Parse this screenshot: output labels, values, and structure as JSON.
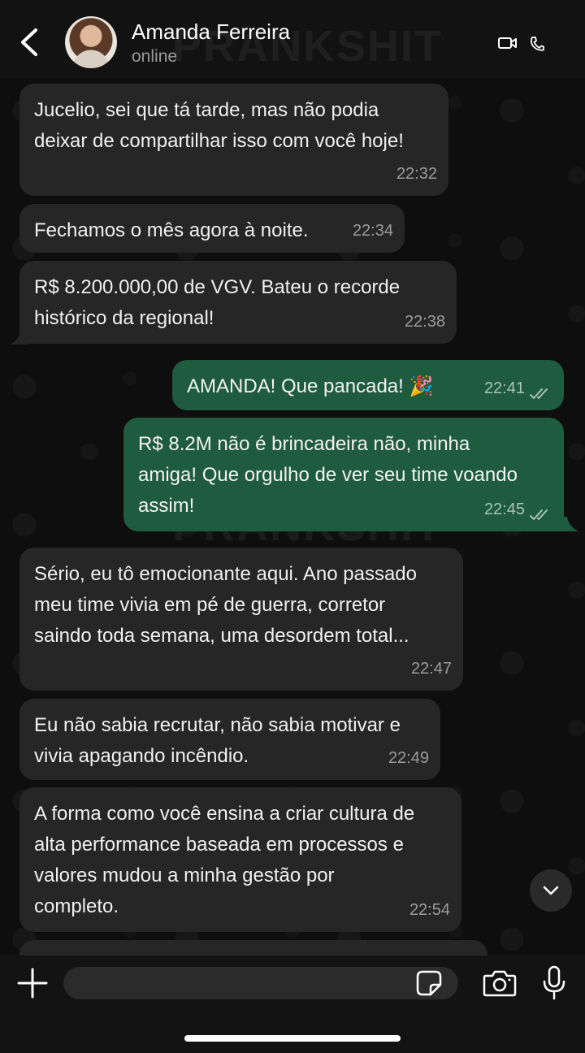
{
  "header": {
    "contact_name": "Amanda Ferreira",
    "status": "online",
    "back_icon": "chevron-left-icon",
    "video_icon": "video-call-icon",
    "phone_icon": "phone-icon"
  },
  "watermark": "PRANKSHIT",
  "messages": [
    {
      "direction": "incoming",
      "text": "Jucelio, sei que tá tarde, mas não podia\ndeixar de compartilhar isso com você hoje!",
      "time": "22:32"
    },
    {
      "direction": "incoming",
      "text": "Fechamos o mês agora à noite.",
      "time": "22:34"
    },
    {
      "direction": "incoming",
      "text": "R$ 8.200.000,00 de VGV. Bateu o recorde\nhistórico da regional!",
      "time": "22:38"
    },
    {
      "direction": "outgoing",
      "text": "AMANDA! Que pancada! 🎉",
      "time": "22:41",
      "status": "read"
    },
    {
      "direction": "outgoing",
      "text": "R$ 8.2M não é brincadeira não, minha\namiga! Que orgulho de ver seu time voando\nassim!",
      "time": "22:45",
      "status": "read"
    },
    {
      "direction": "incoming",
      "text": "Sério, eu tô emocionante aqui. Ano passado\nmeu time vivia em pé de guerra, corretor\nsaindo toda semana, uma desordem total...",
      "time": "22:47"
    },
    {
      "direction": "incoming",
      "text": "Eu não sabia recrutar, não sabia motivar e\nvivia apagando incêndio.",
      "time": "22:49"
    },
    {
      "direction": "incoming",
      "text": "A forma como você ensina a criar cultura de\nalta performance baseada em processos e\nvalores mudou a minha gestão por\ncompleto.",
      "time": "22:54"
    }
  ],
  "composer": {
    "placeholder": "",
    "attach_icon": "plus-icon",
    "sticker_icon": "sticker-icon",
    "camera_icon": "camera-icon",
    "mic_icon": "microphone-icon",
    "scroll_icon": "chevron-down-icon"
  },
  "colors": {
    "incoming_bubble": "#262626",
    "outgoing_bubble": "#1f5b3e",
    "background": "#0e0e0e"
  }
}
